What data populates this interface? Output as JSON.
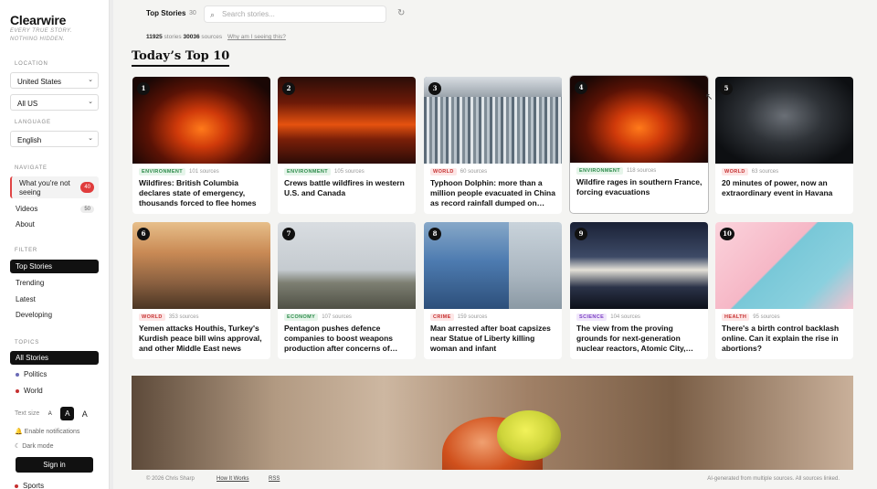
{
  "sidebar": {
    "brand": "Clearwire",
    "tagline": "EVERY TRUE STORY. NOTHING HIDDEN.",
    "location_label": "LOCATION",
    "country": "United States",
    "region": "All US",
    "language_label": "LANGUAGE",
    "language": "English",
    "navigate_label": "NAVIGATE",
    "nav": [
      {
        "label": "What you're not seeing",
        "badge": "40"
      },
      {
        "label": "Videos",
        "badge": "50"
      },
      {
        "label": "About"
      }
    ],
    "filter_label": "FILTER",
    "filters": [
      "Top Stories",
      "Trending",
      "Latest",
      "Developing"
    ],
    "topics_label": "TOPICS",
    "topics": [
      {
        "label": "All Stories"
      },
      {
        "label": "Politics",
        "dot": "#6b6bb6"
      },
      {
        "label": "World",
        "dot": "#c53030"
      }
    ],
    "text_size_label": "Text size",
    "text_sizes": [
      "A",
      "A",
      "A"
    ],
    "notifications": "Enable notifications",
    "dark_mode": "Dark mode",
    "signin": "Sign in",
    "sports": "Sports"
  },
  "topbar": {
    "title": "Top Stories",
    "count": "30",
    "search_placeholder": "Search stories..."
  },
  "stats": {
    "stories_num": "11925",
    "stories_label": "stories",
    "sources_num": "30036",
    "sources_label": "sources",
    "why": "Why am I seeing this?"
  },
  "page_title": "Today’s Top 10",
  "cards": [
    {
      "rank": "1",
      "cat": "ENVIRONMENT",
      "sources": "101 sources",
      "headline": "Wildfires: British Columbia declares state of emergency, thousands forced to flee homes"
    },
    {
      "rank": "2",
      "cat": "ENVIRONMENT",
      "sources": "105 sources",
      "headline": "Crews battle wildfires in western U.S. and Canada"
    },
    {
      "rank": "3",
      "cat": "WORLD",
      "sources": "60 sources",
      "headline": "Typhoon Dolphin: more than a million people evacuated in China as record rainfall dumped on…"
    },
    {
      "rank": "4",
      "cat": "ENVIRONMENT",
      "sources": "118 sources",
      "headline": "Wildfire rages in southern France, forcing evacuations"
    },
    {
      "rank": "5",
      "cat": "WORLD",
      "sources": "63 sources",
      "headline": "20 minutes of power, now an extraordinary event in Havana"
    },
    {
      "rank": "6",
      "cat": "WORLD",
      "sources": "353 sources",
      "headline": "Yemen attacks Houthis, Turkey's Kurdish peace bill wins approval, and other Middle East news"
    },
    {
      "rank": "7",
      "cat": "ECONOMY",
      "sources": "107 sources",
      "headline": "Pentagon pushes defence companies to boost weapons production after concerns of…"
    },
    {
      "rank": "8",
      "cat": "CRIME",
      "sources": "159 sources",
      "headline": "Man arrested after boat capsizes near Statue of Liberty killing woman and infant"
    },
    {
      "rank": "9",
      "cat": "SCIENCE",
      "sources": "104 sources",
      "headline": "The view from the proving grounds for next-generation nuclear reactors, Atomic City,…"
    },
    {
      "rank": "10",
      "cat": "HEALTH",
      "sources": "95 sources",
      "headline": "There's a birth control backlash online. Can it explain the rise in abortions?"
    }
  ],
  "footer": {
    "copyright": "© 2026 Chris Sharp",
    "how": "How It Works",
    "rss": "RSS",
    "note": "AI-generated from multiple sources. All sources linked."
  }
}
